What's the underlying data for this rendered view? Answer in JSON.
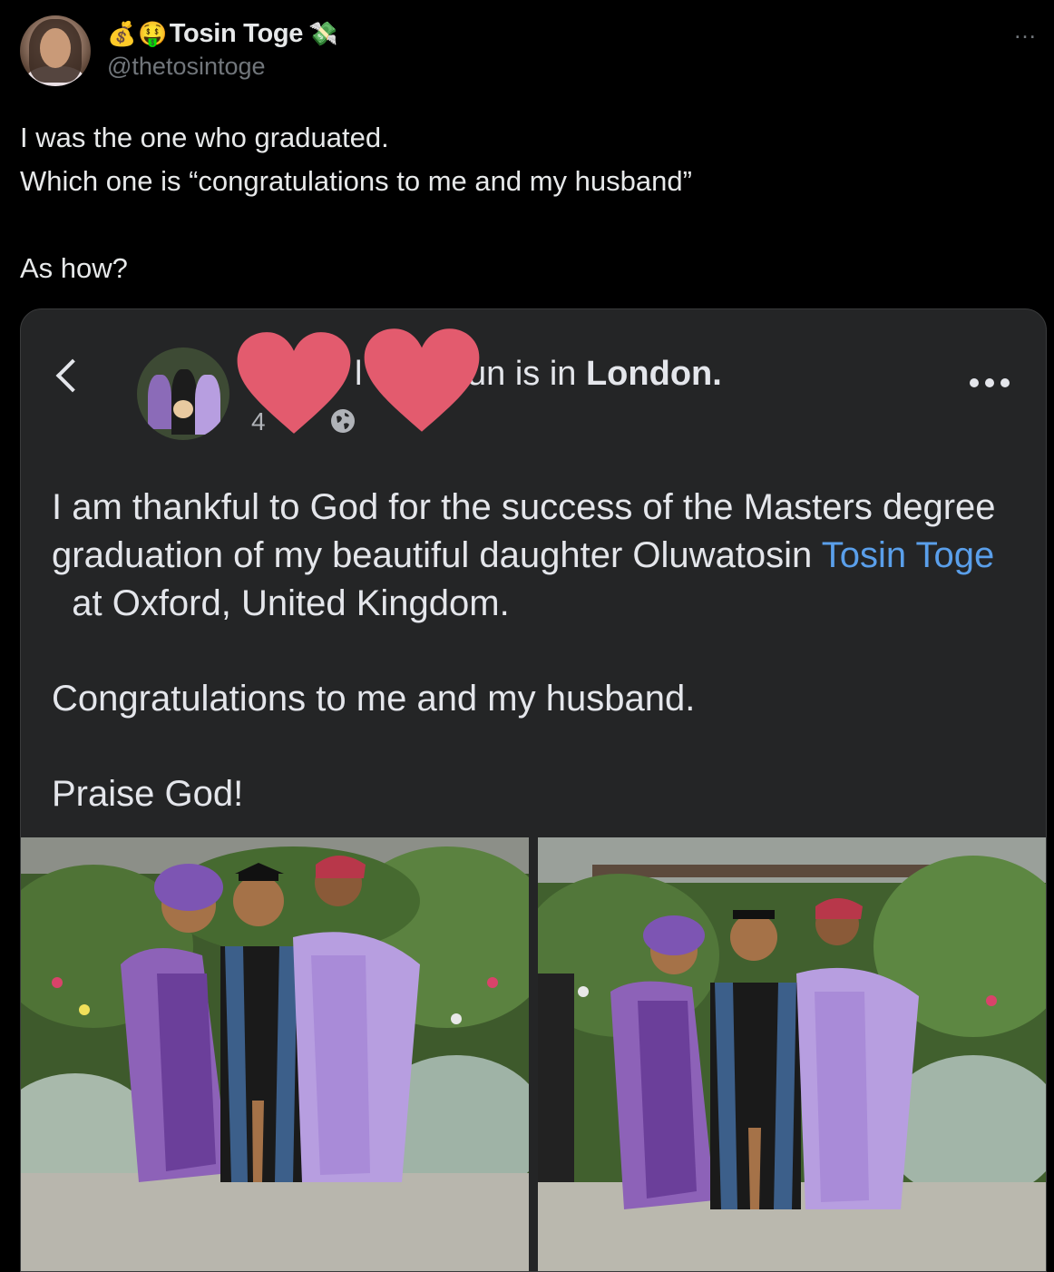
{
  "tweet": {
    "display_name": "Tosin Toge",
    "handle": "@thetosintoge",
    "prefix_emojis": [
      "💰",
      "🤑"
    ],
    "suffix_emoji": "💸",
    "more_icon": "…",
    "lines": [
      "I was the one who graduated.",
      "Which one is “congratulations to me and my husband”",
      "As how?"
    ]
  },
  "facebook_post": {
    "name_visible_fragment": "un is in ",
    "location": "London.",
    "time_fragment": "4",
    "redaction_icon": "heart",
    "redaction_color": "#e35b6e",
    "paragraph1_before_link": "I am thankful to God for the success of the Masters degree graduation of my beautiful daughter Oluwatosin ",
    "paragraph1_link": "Tosin Toge",
    "paragraph1_after_link": "  at Oxford, United Kingdom.",
    "paragraph2": "Congratulations to me and my husband.",
    "paragraph3": "Praise God!",
    "link_color": "#5a9fea",
    "photos": [
      "graduation-photo-1",
      "graduation-photo-2"
    ]
  }
}
